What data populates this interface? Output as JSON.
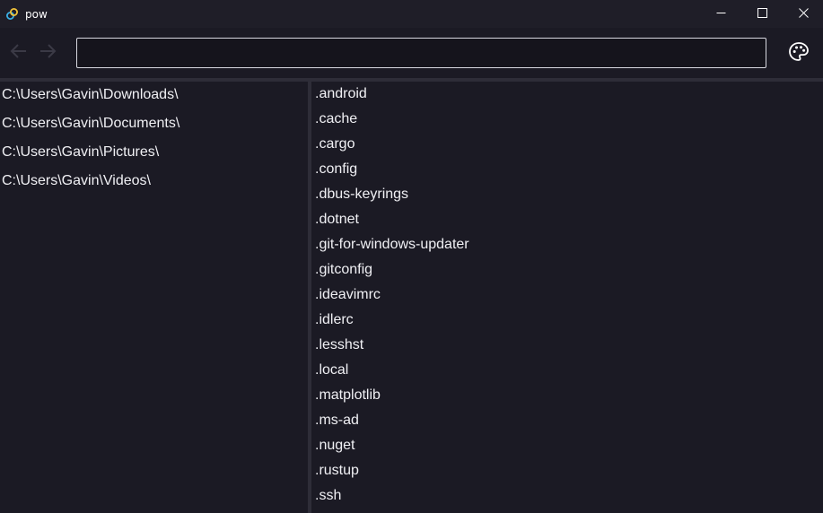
{
  "window": {
    "title": "pow",
    "icon": "app-link-icon",
    "controls": [
      "minimize-icon",
      "maximize-icon",
      "close-icon"
    ]
  },
  "toolbar": {
    "back_icon": "arrow-left-icon",
    "forward_icon": "arrow-right-icon",
    "path_value": "",
    "theme_icon": "palette-icon"
  },
  "sidebar": {
    "items": [
      {
        "label": "C:\\Users\\Gavin\\Downloads\\"
      },
      {
        "label": "C:\\Users\\Gavin\\Documents\\"
      },
      {
        "label": "C:\\Users\\Gavin\\Pictures\\"
      },
      {
        "label": "C:\\Users\\Gavin\\Videos\\"
      }
    ]
  },
  "files": {
    "items": [
      {
        "name": ".android"
      },
      {
        "name": ".cache"
      },
      {
        "name": ".cargo"
      },
      {
        "name": ".config"
      },
      {
        "name": ".dbus-keyrings"
      },
      {
        "name": ".dotnet"
      },
      {
        "name": ".git-for-windows-updater"
      },
      {
        "name": ".gitconfig"
      },
      {
        "name": ".ideavimrc"
      },
      {
        "name": ".idlerc"
      },
      {
        "name": ".lesshst"
      },
      {
        "name": ".local"
      },
      {
        "name": ".matplotlib"
      },
      {
        "name": ".ms-ad"
      },
      {
        "name": ".nuget"
      },
      {
        "name": ".rustup"
      },
      {
        "name": ".ssh"
      }
    ]
  },
  "colors": {
    "background": "#1b1a24",
    "titlebar": "#1f1e28",
    "divider": "#2e2d38",
    "text": "#f0f0f4"
  }
}
